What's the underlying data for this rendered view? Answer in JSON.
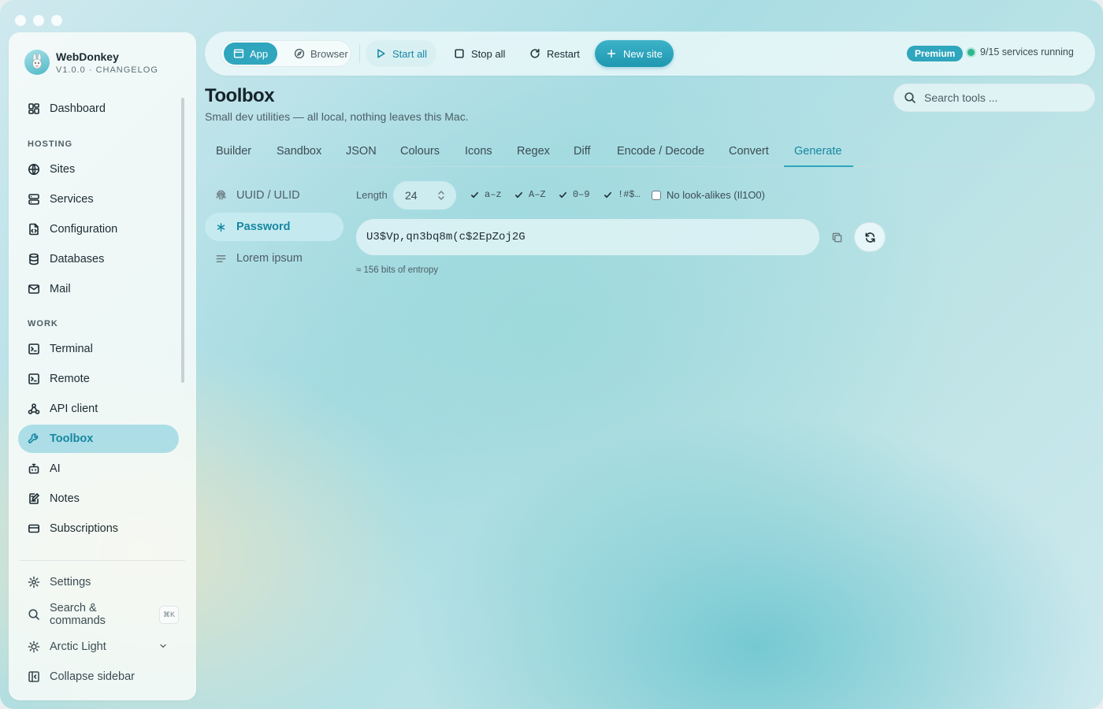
{
  "app": {
    "name": "WebDonkey",
    "version_line": "V1.0.0 · CHANGELOG"
  },
  "sidebar": {
    "top_items": [
      {
        "label": "Dashboard",
        "icon": "dashboard-icon"
      }
    ],
    "sections": [
      {
        "title": "HOSTING",
        "items": [
          {
            "label": "Sites",
            "icon": "globe-icon"
          },
          {
            "label": "Services",
            "icon": "server-icon"
          },
          {
            "label": "Configuration",
            "icon": "file-code-icon"
          },
          {
            "label": "Databases",
            "icon": "database-icon"
          },
          {
            "label": "Mail",
            "icon": "mail-icon"
          }
        ]
      },
      {
        "title": "WORK",
        "items": [
          {
            "label": "Terminal",
            "icon": "terminal-icon"
          },
          {
            "label": "Remote",
            "icon": "terminal-icon"
          },
          {
            "label": "API client",
            "icon": "webhook-icon"
          },
          {
            "label": "Toolbox",
            "icon": "wrench-icon",
            "active": true
          },
          {
            "label": "AI",
            "icon": "bot-icon"
          },
          {
            "label": "Notes",
            "icon": "notes-icon"
          },
          {
            "label": "Subscriptions",
            "icon": "credit-card-icon"
          }
        ]
      }
    ],
    "bottom": {
      "settings": "Settings",
      "search": "Search & commands",
      "search_shortcut": "⌘K",
      "theme": "Arctic Light",
      "collapse": "Collapse sidebar"
    }
  },
  "toolbar": {
    "mode_app": "App",
    "mode_browser": "Browser",
    "start_all": "Start all",
    "stop_all": "Stop all",
    "restart": "Restart",
    "new_site": "New site",
    "badge": "Premium",
    "status": "9/15 services running"
  },
  "page": {
    "title": "Toolbox",
    "subtitle": "Small dev utilities — all local, nothing leaves this Mac.",
    "search_placeholder": "Search tools ..."
  },
  "tabs": [
    {
      "label": "Builder"
    },
    {
      "label": "Sandbox"
    },
    {
      "label": "JSON"
    },
    {
      "label": "Colours"
    },
    {
      "label": "Icons"
    },
    {
      "label": "Regex"
    },
    {
      "label": "Diff"
    },
    {
      "label": "Encode / Decode"
    },
    {
      "label": "Convert"
    },
    {
      "label": "Generate",
      "active": true
    }
  ],
  "generate": {
    "subnav": [
      {
        "label": "UUID / ULID",
        "icon": "fingerprint-icon"
      },
      {
        "label": "Password",
        "icon": "asterisk-icon",
        "active": true
      },
      {
        "label": "Lorem ipsum",
        "icon": "text-lines-icon"
      }
    ],
    "length_label": "Length",
    "length_value": "24",
    "options": [
      {
        "label": "a–z",
        "checked": true
      },
      {
        "label": "A–Z",
        "checked": true
      },
      {
        "label": "0–9",
        "checked": true
      },
      {
        "label": "!#$…",
        "checked": true
      },
      {
        "label": "No look-alikes (Il1O0)",
        "checked": false
      }
    ],
    "password": "U3$Vp,qn3bq8m(c$2EpZoj2G",
    "entropy": "≈ 156 bits of entropy"
  },
  "colors": {
    "accent": "#2fa6bd",
    "accent_text": "#1787a1",
    "status_ok": "#2eb88e"
  }
}
